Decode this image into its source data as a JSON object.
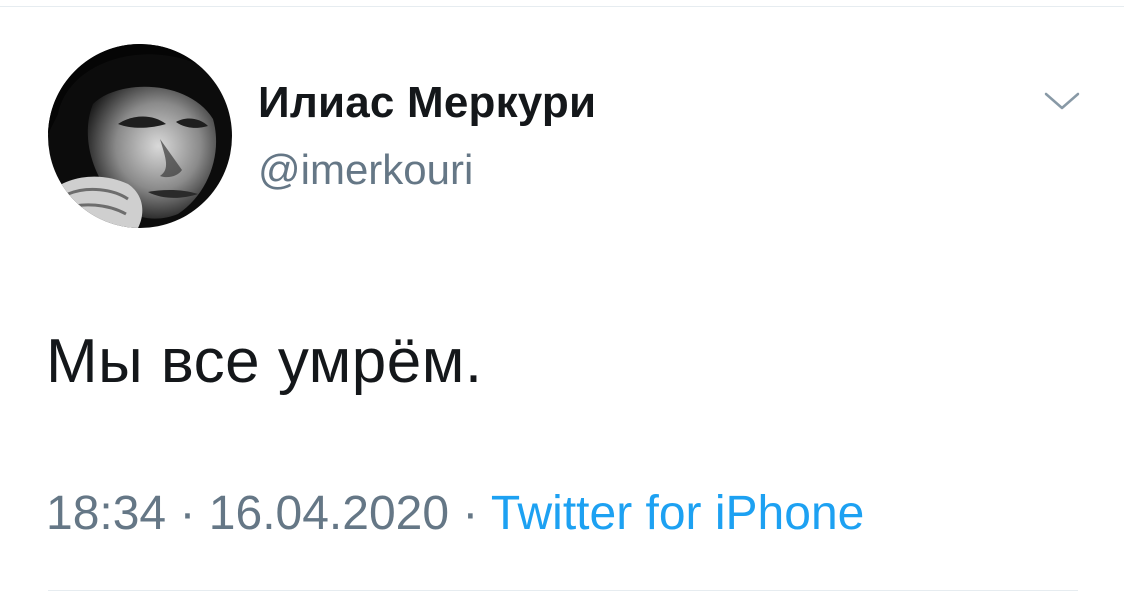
{
  "tweet": {
    "author": {
      "display_name": "Илиас Меркури",
      "handle": "@imerkouri"
    },
    "text": "Мы все умрём.",
    "time": "18:34",
    "date": "16.04.2020",
    "separator": "·",
    "source": "Twitter for iPhone"
  },
  "icons": {
    "menu": "chevron-down-icon"
  },
  "colors": {
    "text_primary": "#14171a",
    "text_secondary": "#657786",
    "link": "#1da1f2",
    "divider": "#e6ecf0"
  }
}
